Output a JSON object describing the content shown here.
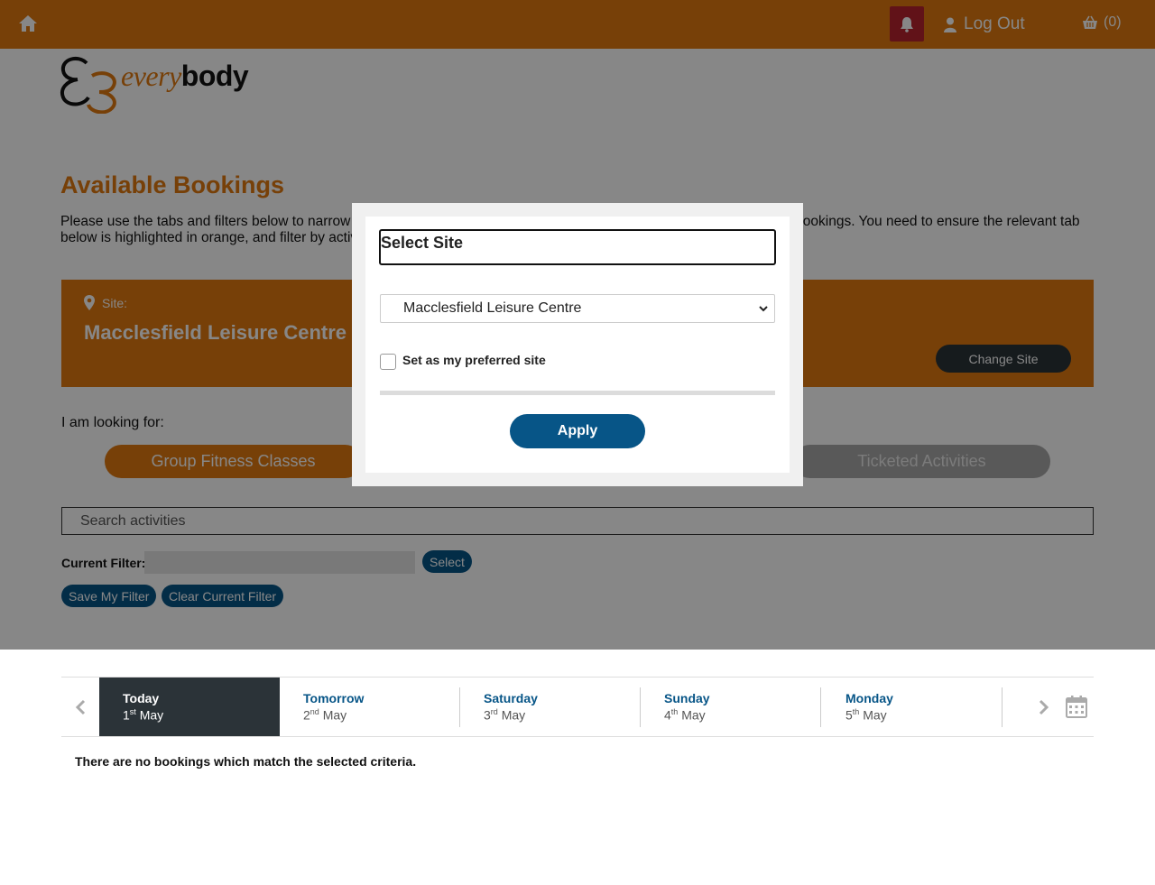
{
  "header": {
    "home_icon": "home-icon",
    "bell_icon": "bell-icon",
    "logout_label": "Log Out",
    "basket_count": "(0)",
    "colors": {
      "bar": "#e07a10",
      "bell_bg": "#b8232f"
    }
  },
  "logo": {
    "part1": "every",
    "part2": "body"
  },
  "page": {
    "title": "Available Bookings",
    "intro": "Please use the tabs and filters below to narrow down your search for group fitness classes, ticketed activities or sports bookings. You need to ensure the relevant tab below is highlighted in orange, and filter by activity, date and time."
  },
  "site_panel": {
    "label": "Site:",
    "name": "Macclesfield Leisure Centre",
    "change_label": "Change Site"
  },
  "looking_for": {
    "label": "I am looking for:",
    "tabs": [
      {
        "label": "Group Fitness Classes",
        "active": true
      },
      {
        "label": "Ticketed Activities",
        "active": false
      }
    ]
  },
  "search": {
    "placeholder": "Search activities"
  },
  "filter": {
    "label": "Current Filter:",
    "select_label": "Select",
    "save_label": "Save My Filter",
    "clear_label": "Clear Current Filter"
  },
  "dates": {
    "days": [
      {
        "name": "Today",
        "num": "1",
        "suffix": "st",
        "month": "May",
        "active": true
      },
      {
        "name": "Tomorrow",
        "num": "2",
        "suffix": "nd",
        "month": "May",
        "active": false
      },
      {
        "name": "Saturday",
        "num": "3",
        "suffix": "rd",
        "month": "May",
        "active": false
      },
      {
        "name": "Sunday",
        "num": "4",
        "suffix": "th",
        "month": "May",
        "active": false
      },
      {
        "name": "Monday",
        "num": "5",
        "suffix": "th",
        "month": "May",
        "active": false
      }
    ]
  },
  "results": {
    "message": "There are no bookings which match the selected criteria."
  },
  "modal": {
    "title": "Select Site",
    "selected_site": "Macclesfield Leisure Centre",
    "preferred_label": "Set as my preferred site",
    "preferred_checked": false,
    "apply_label": "Apply"
  }
}
